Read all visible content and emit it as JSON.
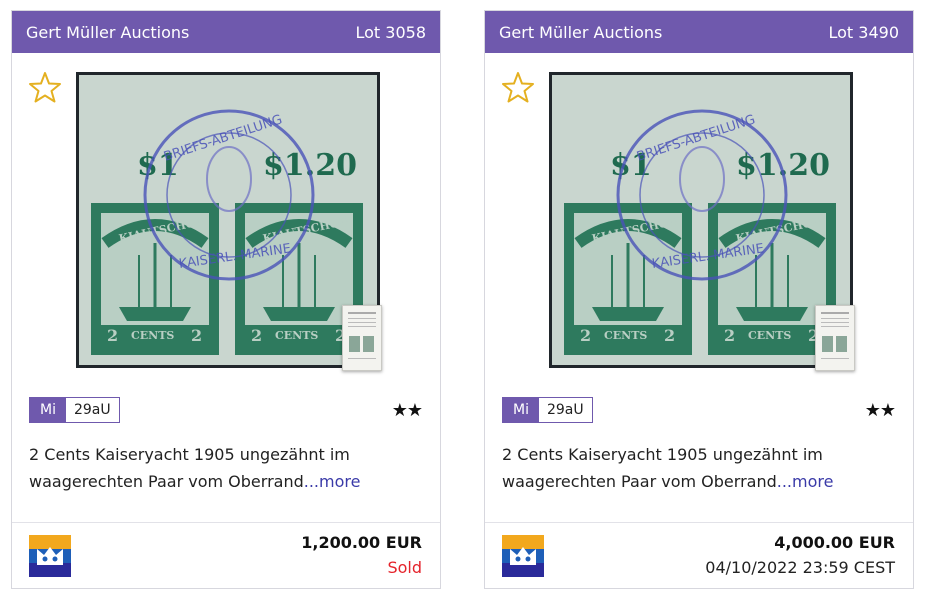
{
  "cards": [
    {
      "auctioneer": "Gert Müller Auctions",
      "lot": "Lot 3058",
      "stamp": {
        "overprint_left": "$1",
        "overprint_right": "$1.20",
        "country": "KIAUTSCHOU",
        "value": "2",
        "currency": "CENTS",
        "cancel_top": "BRIEFS-ABTEILUNG",
        "cancel_bottom": "KAISERL. MARINE"
      },
      "catalog": {
        "name": "Mi",
        "number": "29aU"
      },
      "condition": "★★",
      "description": "2 Cents Kaiseryacht 1905 ungezähnt im waagerechten Paar vom Oberrand",
      "more": "...more",
      "price": "1,200.00 EUR",
      "status": "Sold"
    },
    {
      "auctioneer": "Gert Müller Auctions",
      "lot": "Lot 3490",
      "stamp": {
        "overprint_left": "$1",
        "overprint_right": "$1.20",
        "country": "KIAUTSCHOU",
        "value": "2",
        "currency": "CENTS",
        "cancel_top": "BRIEFS-ABTEILUNG",
        "cancel_bottom": "KAISERL. MARINE"
      },
      "catalog": {
        "name": "Mi",
        "number": "29aU"
      },
      "condition": "★★",
      "description": "2 Cents Kaiseryacht 1905 ungezähnt im waagerechten Paar vom Oberrand",
      "more": "...more",
      "price": "4,000.00 EUR",
      "status": "04/10/2022 23:59 CEST"
    }
  ],
  "colors": {
    "header": "#6f59ad",
    "star_outline": "#e4b020",
    "stamp_green": "#2e7a5e",
    "cancel_blue": "#4a52b8",
    "sold": "#e5232b"
  },
  "icons": {
    "watch": "star-outline-icon",
    "seller": "seller-logo-icon",
    "certificate": "certificate-thumbnail"
  }
}
